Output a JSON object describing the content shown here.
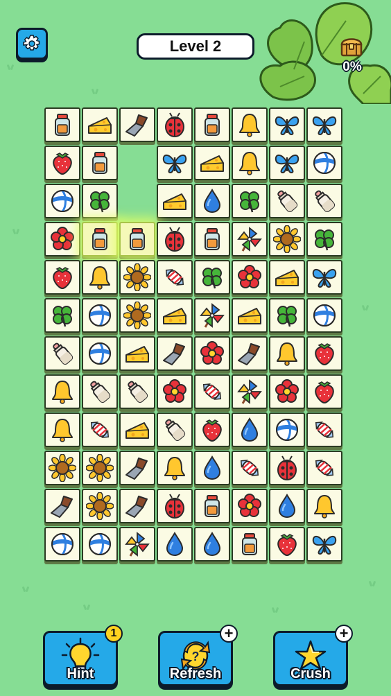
{
  "header": {
    "level_label": "Level 2",
    "progress_percent": "0%"
  },
  "board": {
    "rows": [
      [
        "jar",
        "cheese",
        "scraper",
        "ladybug",
        "jar",
        "bell",
        "butterfly",
        "butterfly"
      ],
      [
        "strawberry",
        "jar",
        null,
        null,
        "butterfly",
        "cheese",
        "bell",
        "butterfly",
        "ball"
      ],
      [
        "ball",
        "clover",
        null,
        "cheese",
        "drop",
        "clover",
        "bottle",
        "bottle"
      ],
      [
        "flower",
        "jar",
        "jar",
        "ladybug",
        "jar",
        "pinwheel",
        "sunflower",
        "clover"
      ],
      [
        "strawberry",
        "bell",
        "sunflower",
        "candy",
        "clover",
        "flower",
        "cheese",
        "butterfly"
      ],
      [
        "clover",
        "ball",
        "sunflower",
        "cheese",
        "pinwheel",
        "cheese",
        "clover",
        "ball"
      ],
      [
        "bottle",
        "ball",
        "cheese",
        "scraper",
        "flower",
        "scraper",
        "bell",
        "strawberry"
      ],
      [
        "bell",
        "bottle",
        "bottle",
        "flower",
        "candy",
        "pinwheel",
        "flower",
        "strawberry"
      ],
      [
        "bell",
        "candy",
        "cheese",
        "bottle",
        "strawberry",
        "drop",
        "ball",
        "candy"
      ],
      [
        "sunflower",
        "sunflower",
        "scraper",
        "bell",
        "drop",
        "candy",
        "ladybug",
        "candy"
      ],
      [
        "scraper",
        "sunflower",
        "scraper",
        "ladybug",
        "jar",
        "flower",
        "drop",
        "bell"
      ],
      [
        "ball",
        "ball",
        "pinwheel",
        "drop",
        "drop",
        "jar",
        "strawberry",
        "butterfly"
      ]
    ]
  },
  "powerups": {
    "hint": {
      "label": "Hint",
      "count": "1",
      "icon": "lightbulb-icon"
    },
    "refresh": {
      "label": "Refresh",
      "badge": "+",
      "icon": "refresh-icon"
    },
    "crush": {
      "label": "Crush",
      "badge": "+",
      "icon": "star-icon"
    }
  },
  "colors": {
    "background": "#86dd94",
    "button": "#25a9e8",
    "tile": "#fbfbe4"
  }
}
